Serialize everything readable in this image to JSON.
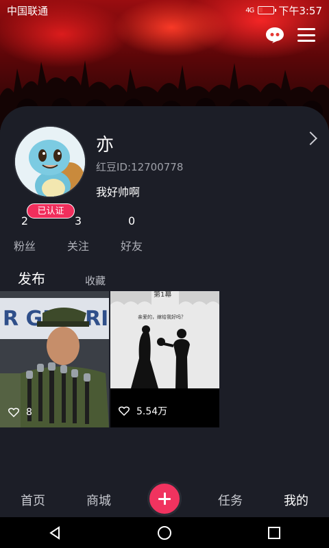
{
  "status": {
    "carrier": "中国联通",
    "time": "下午3:57",
    "signal": "4G"
  },
  "profile": {
    "nickname": "亦",
    "uid": "红豆ID:12700778",
    "bio": "我好帅啊",
    "badge": "已认证"
  },
  "stats": [
    {
      "num": "2",
      "label": "粉丝"
    },
    {
      "num": "3",
      "label": "关注"
    },
    {
      "num": "0",
      "label": "好友"
    }
  ],
  "tabs": [
    "发布",
    "收藏"
  ],
  "posts": [
    {
      "likes": "8"
    },
    {
      "likes": "5.54万",
      "caption": "亲爱的，嫁给我好吗？",
      "title": "第1幕"
    }
  ],
  "nav": {
    "home": "首页",
    "mall": "商城",
    "tasks": "任务",
    "mine": "我的"
  },
  "colors": {
    "accent": "#f0335f",
    "bg": "#1c1e27"
  }
}
